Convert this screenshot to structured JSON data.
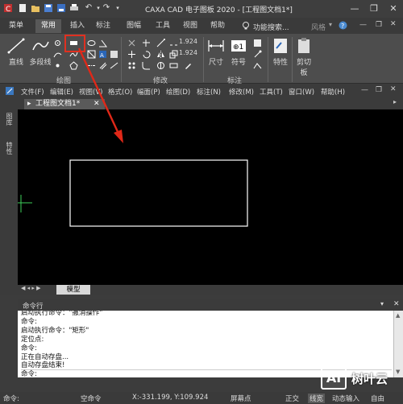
{
  "app": {
    "title": "CAXA CAD 电子图板 2020 - [工程图文档1*]"
  },
  "tabs": [
    {
      "label": "菜单"
    },
    {
      "label": "常用"
    },
    {
      "label": "插入"
    },
    {
      "label": "标注"
    },
    {
      "label": "图幅"
    },
    {
      "label": "工具"
    },
    {
      "label": "视图"
    },
    {
      "label": "帮助"
    }
  ],
  "search_label": "功能搜索...",
  "style_label": "风格",
  "ribbon": {
    "draw_line": "直线",
    "draw_polyline": "多段线",
    "dimension": "尺寸",
    "symbol": "符号",
    "properties": "特性",
    "clipboard": "剪切板",
    "coords": [
      "1.924",
      "1.924"
    ],
    "group_draw": "绘图",
    "group_modify": "修改",
    "group_annotate": "标注"
  },
  "menubar": [
    {
      "label": "文件(F)"
    },
    {
      "label": "编辑(E)"
    },
    {
      "label": "视图(V)"
    },
    {
      "label": "格式(O)"
    },
    {
      "label": "幅面(P)"
    },
    {
      "label": "绘图(D)"
    },
    {
      "label": "标注(N)"
    },
    {
      "label": "修改(M)"
    },
    {
      "label": "工具(T)"
    },
    {
      "label": "窗口(W)"
    },
    {
      "label": "帮助(H)"
    }
  ],
  "doc_tab": "工程图文档1*",
  "left_dock": {
    "panel1": "图库",
    "panel2": "特性"
  },
  "model_tab": "模型",
  "command_panel": {
    "title": "命令行",
    "lines": [
      "启动执行命令：\"撤消操作\"",
      "命令:",
      "启动执行命令：\"矩形\"",
      "定位点:",
      "命令:",
      "正在自动存盘...",
      "自动存盘结束!"
    ],
    "prompt": "命令:"
  },
  "status": {
    "left": "命令:",
    "mode": "空命令",
    "coords": "X:-331.199, Y:109.924",
    "snap": "屏幕点",
    "ortho": "正交",
    "linewidth": "线宽",
    "dynamic_input": "动态输入",
    "free": "自由"
  },
  "watermark": {
    "badge": "AI",
    "text": "树叶云"
  },
  "colors": {
    "highlight_box": "#e03020",
    "arrow": "#e02818",
    "canvas": "#000000",
    "drawing": "#ffffff"
  }
}
